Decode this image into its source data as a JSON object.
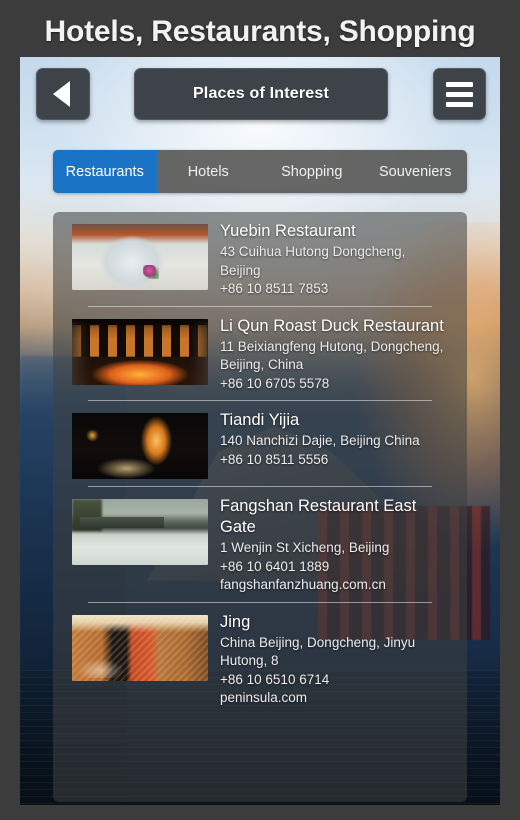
{
  "page_title": "Hotels, Restaurants, Shopping",
  "topbar": {
    "back_label": "",
    "title": "Places of Interest",
    "menu_label": ""
  },
  "tabs": [
    {
      "label": "Restaurants",
      "active": true
    },
    {
      "label": "Hotels",
      "active": false
    },
    {
      "label": "Shopping",
      "active": false
    },
    {
      "label": "Souveniers",
      "active": false
    }
  ],
  "colors": {
    "accent_blue": "#1b73c5",
    "tabbar_bg": "#525250",
    "frame_bg": "#3c3c3c",
    "button_bg": "#3e434a"
  },
  "list": [
    {
      "name": "Yuebin Restaurant",
      "lines": [
        "43 Cuihua Hutong Dongcheng, Beijing",
        "+86 10 8511 7853"
      ],
      "thumb": "teacup-photo"
    },
    {
      "name": "Li Qun Roast Duck Restaurant",
      "lines": [
        "11 Beixiangfeng Hutong, Dongcheng, Beijing, China",
        "+86 10 6705 5578"
      ],
      "thumb": "roast-duck-photo"
    },
    {
      "name": "Tiandi Yijia",
      "lines": [
        "140 Nanchizi Dajie, Beijing China",
        "+86 10 8511 5556"
      ],
      "thumb": "interior-photo"
    },
    {
      "name": "Fangshan Restaurant East Gate",
      "lines": [
        "1 Wenjin St Xicheng, Beijing",
        "+86 10 6401 1889",
        "fangshanfanzhuang.com.cn"
      ],
      "thumb": "river-photo"
    },
    {
      "name": "Jing",
      "lines": [
        "China Beijing, Dongcheng, Jinyu Hutong, 8",
        "+86 10 6510 6714",
        "peninsula.com"
      ],
      "thumb": "lantern-photo"
    }
  ]
}
